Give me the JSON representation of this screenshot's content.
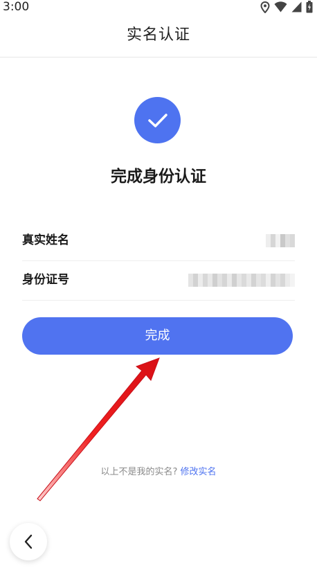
{
  "status_bar": {
    "time": "3:00",
    "icons": [
      "location-icon",
      "wifi-icon",
      "signal-icon",
      "battery-icon"
    ]
  },
  "header": {
    "title": "实名认证"
  },
  "result": {
    "icon": "check-icon",
    "heading": "完成身份认证"
  },
  "info": {
    "name_label": "真实姓名",
    "id_label": "身份证号"
  },
  "actions": {
    "done_label": "完成",
    "back_icon": "chevron-left-icon"
  },
  "footer": {
    "question": "以上不是我的实名?",
    "link": "修改实名"
  },
  "colors": {
    "accent": "#4e73f0",
    "annotation_arrow": "#e5141a"
  }
}
